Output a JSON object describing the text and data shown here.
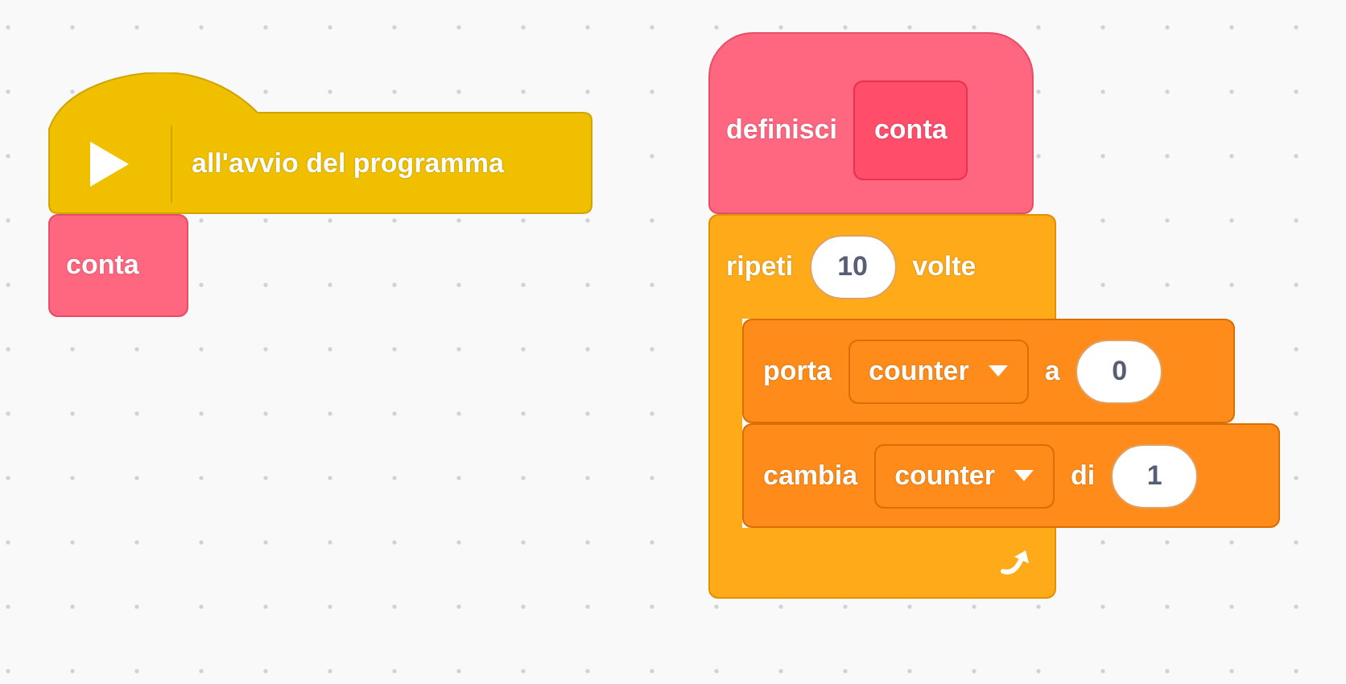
{
  "scripts": [
    {
      "blocks": [
        {
          "kind": "when_flag",
          "label": "all'avvio del programma"
        },
        {
          "kind": "call",
          "label": "conta"
        }
      ]
    },
    {
      "blocks": [
        {
          "kind": "define",
          "label": "definisci",
          "name": "conta"
        },
        {
          "kind": "repeat",
          "parts": [
            {
              "kind": "text",
              "text": "ripeti"
            },
            {
              "kind": "number",
              "text": "10"
            },
            {
              "kind": "text",
              "text": "volte"
            }
          ],
          "children": [
            {
              "kind": "data",
              "parts": [
                {
                  "kind": "text",
                  "text": "porta"
                },
                {
                  "kind": "dropdown",
                  "text": "counter"
                },
                {
                  "kind": "text",
                  "text": "a"
                },
                {
                  "kind": "number",
                  "text": "0"
                }
              ]
            },
            {
              "kind": "data",
              "parts": [
                {
                  "kind": "text",
                  "text": "cambia"
                },
                {
                  "kind": "dropdown",
                  "text": "counter"
                },
                {
                  "kind": "text",
                  "text": "di"
                },
                {
                  "kind": "number",
                  "text": "1"
                }
              ]
            }
          ]
        }
      ]
    }
  ]
}
